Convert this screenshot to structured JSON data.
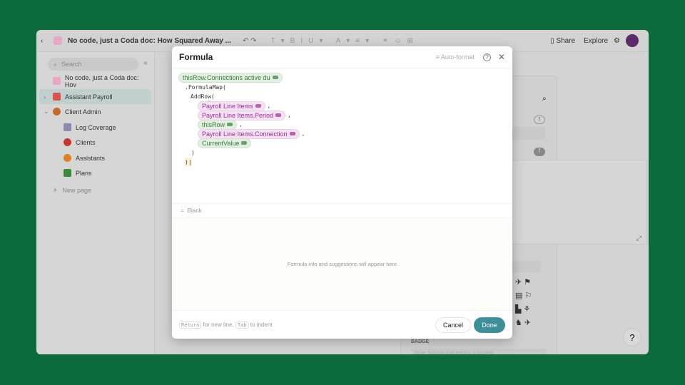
{
  "topbar": {
    "doc_title": "No code, just a Coda doc: How Squared Away ...",
    "share": "Share",
    "explore": "Explore"
  },
  "sidebar": {
    "search_placeholder": "Search",
    "items": [
      {
        "label": "No code, just a Coda doc: Hov",
        "color": "#e8a6c8"
      },
      {
        "label": "Assistant Payroll",
        "color": "#d9534f"
      },
      {
        "label": "Client Admin",
        "color": "#c36a2d"
      },
      {
        "label": "Log Coverage",
        "color": "#8a8ab0"
      },
      {
        "label": "Clients",
        "color": "#c0392b"
      },
      {
        "label": "Assistants",
        "color": "#e67e22"
      },
      {
        "label": "Plans",
        "color": "#3a8a3a"
      }
    ],
    "new_page": "New page"
  },
  "background": {
    "badge_label": "BADGE",
    "badge_placeholder": "Enter formula that returns a number"
  },
  "dialog": {
    "title": "Formula",
    "auto_format": "Auto-format",
    "code": {
      "l1": "thisRow.Connections active du",
      "l2": ".FormulaMap(",
      "l3": "AddRow(",
      "l4": "Payroll Line Items",
      "l5": "Payroll Line Items.Period",
      "l6": "thisRow",
      "l7": "Payroll Line Items.Connection",
      "l8": "CurrentValue",
      "close_paren": ")",
      "close_end": ")|",
      "comma": ","
    },
    "blank": "Blank",
    "suggestions": "Formula info and suggestions will appear here",
    "footer": {
      "key1": "Return",
      "text1": "for new line,",
      "key2": "Tab",
      "text2": "to indent"
    },
    "cancel": "Cancel",
    "done": "Done"
  },
  "colors": {
    "accent": "#3d8f99",
    "bg": "#0d6a3c"
  },
  "help": "?"
}
